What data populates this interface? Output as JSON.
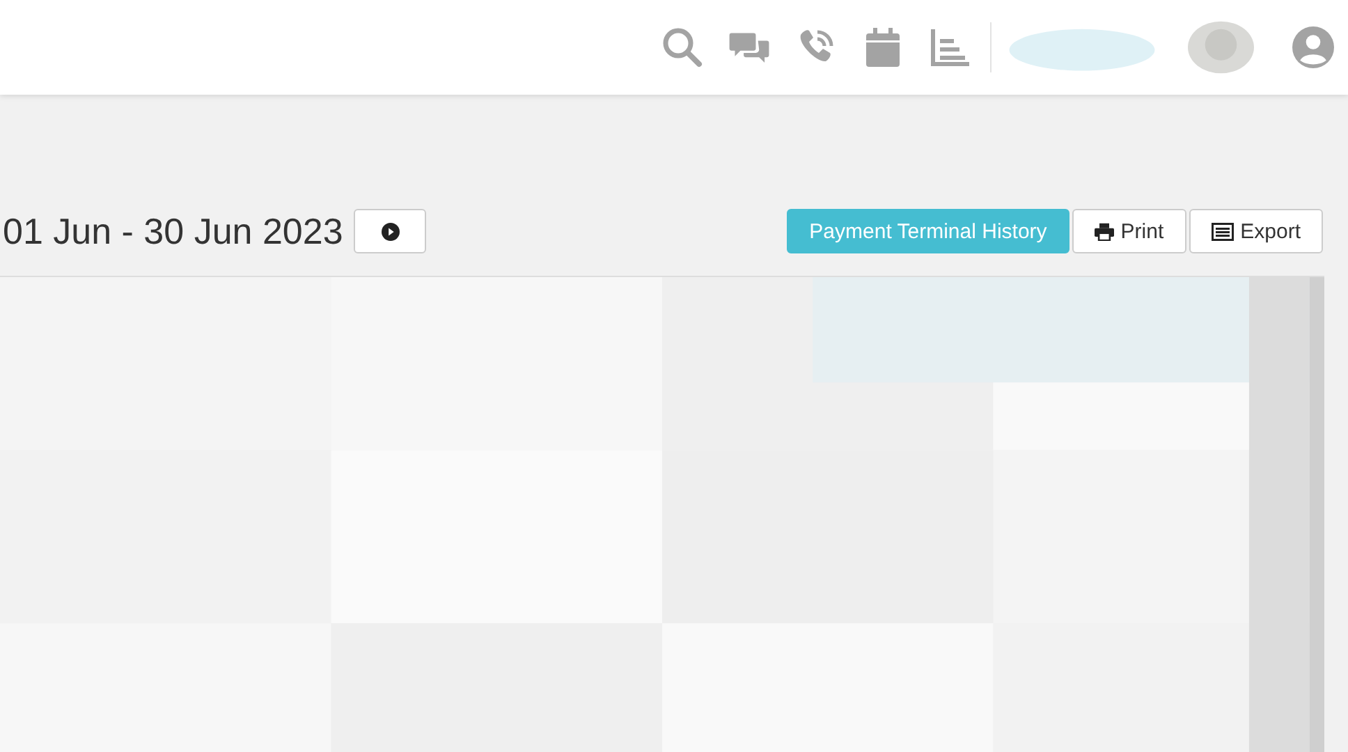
{
  "toolbar": {
    "date_range": "01 Jun - 30 Jun 2023",
    "buttons": [
      {
        "kind": "primary",
        "label": "Payment Terminal History"
      },
      {
        "kind": "print",
        "label": "Print"
      },
      {
        "kind": "export",
        "label": "Export"
      }
    ]
  }
}
